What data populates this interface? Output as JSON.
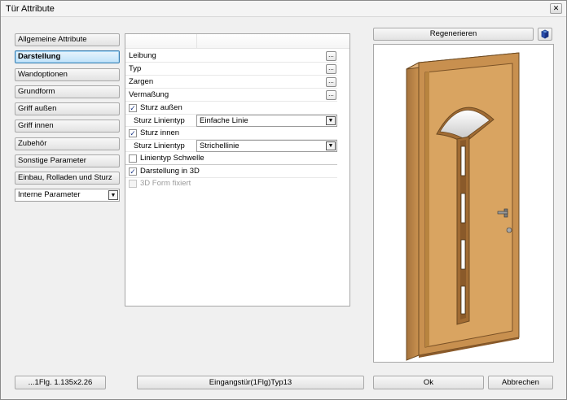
{
  "window": {
    "title": "Tür Attribute",
    "close_glyph": "✕"
  },
  "nav": {
    "items": [
      {
        "label": "Allgemeine Attribute"
      },
      {
        "label": "Darstellung"
      },
      {
        "label": "Wandoptionen"
      },
      {
        "label": "Grundform"
      },
      {
        "label": "Griff außen"
      },
      {
        "label": "Griff innen"
      },
      {
        "label": "Zubehör"
      },
      {
        "label": "Sonstige Parameter"
      },
      {
        "label": "Einbau, Rolladen und Sturz"
      }
    ],
    "active_index": 1,
    "dropdown": {
      "value": "Interne Parameter",
      "arrow_glyph": "▼"
    }
  },
  "properties": {
    "ellipsis_glyph": "...",
    "check_glyph": "✓",
    "combo_arrow_glyph": "▼",
    "leibung": "Leibung",
    "typ": "Typ",
    "zargen": "Zargen",
    "vermassung": "Vermaßung",
    "sturz_aussen": {
      "label": "Sturz außen",
      "checked": true
    },
    "sturz_aussen_linientyp": {
      "label": "Sturz Linientyp",
      "value": "Einfache Linie"
    },
    "sturz_innen": {
      "label": "Sturz innen",
      "checked": true
    },
    "sturz_innen_linientyp": {
      "label": "Sturz Linientyp",
      "value": "Strichellinie"
    },
    "linientyp_schwelle": {
      "label": "Linientyp Schwelle",
      "checked": false
    },
    "darstellung_3d": {
      "label": "Darstellung in 3D",
      "checked": true
    },
    "form_fixiert": {
      "label": "3D Form fixiert",
      "checked": false,
      "disabled": true
    }
  },
  "preview": {
    "regenerate_label": "Regenerieren",
    "door_color": "#d9a461",
    "frame_color": "#c8904f"
  },
  "footer": {
    "size_label": "...1Flg. 1.135x2.26",
    "type_label": "Eingangstür(1Flg)Typ13",
    "ok_label": "Ok",
    "cancel_label": "Abbrechen"
  }
}
